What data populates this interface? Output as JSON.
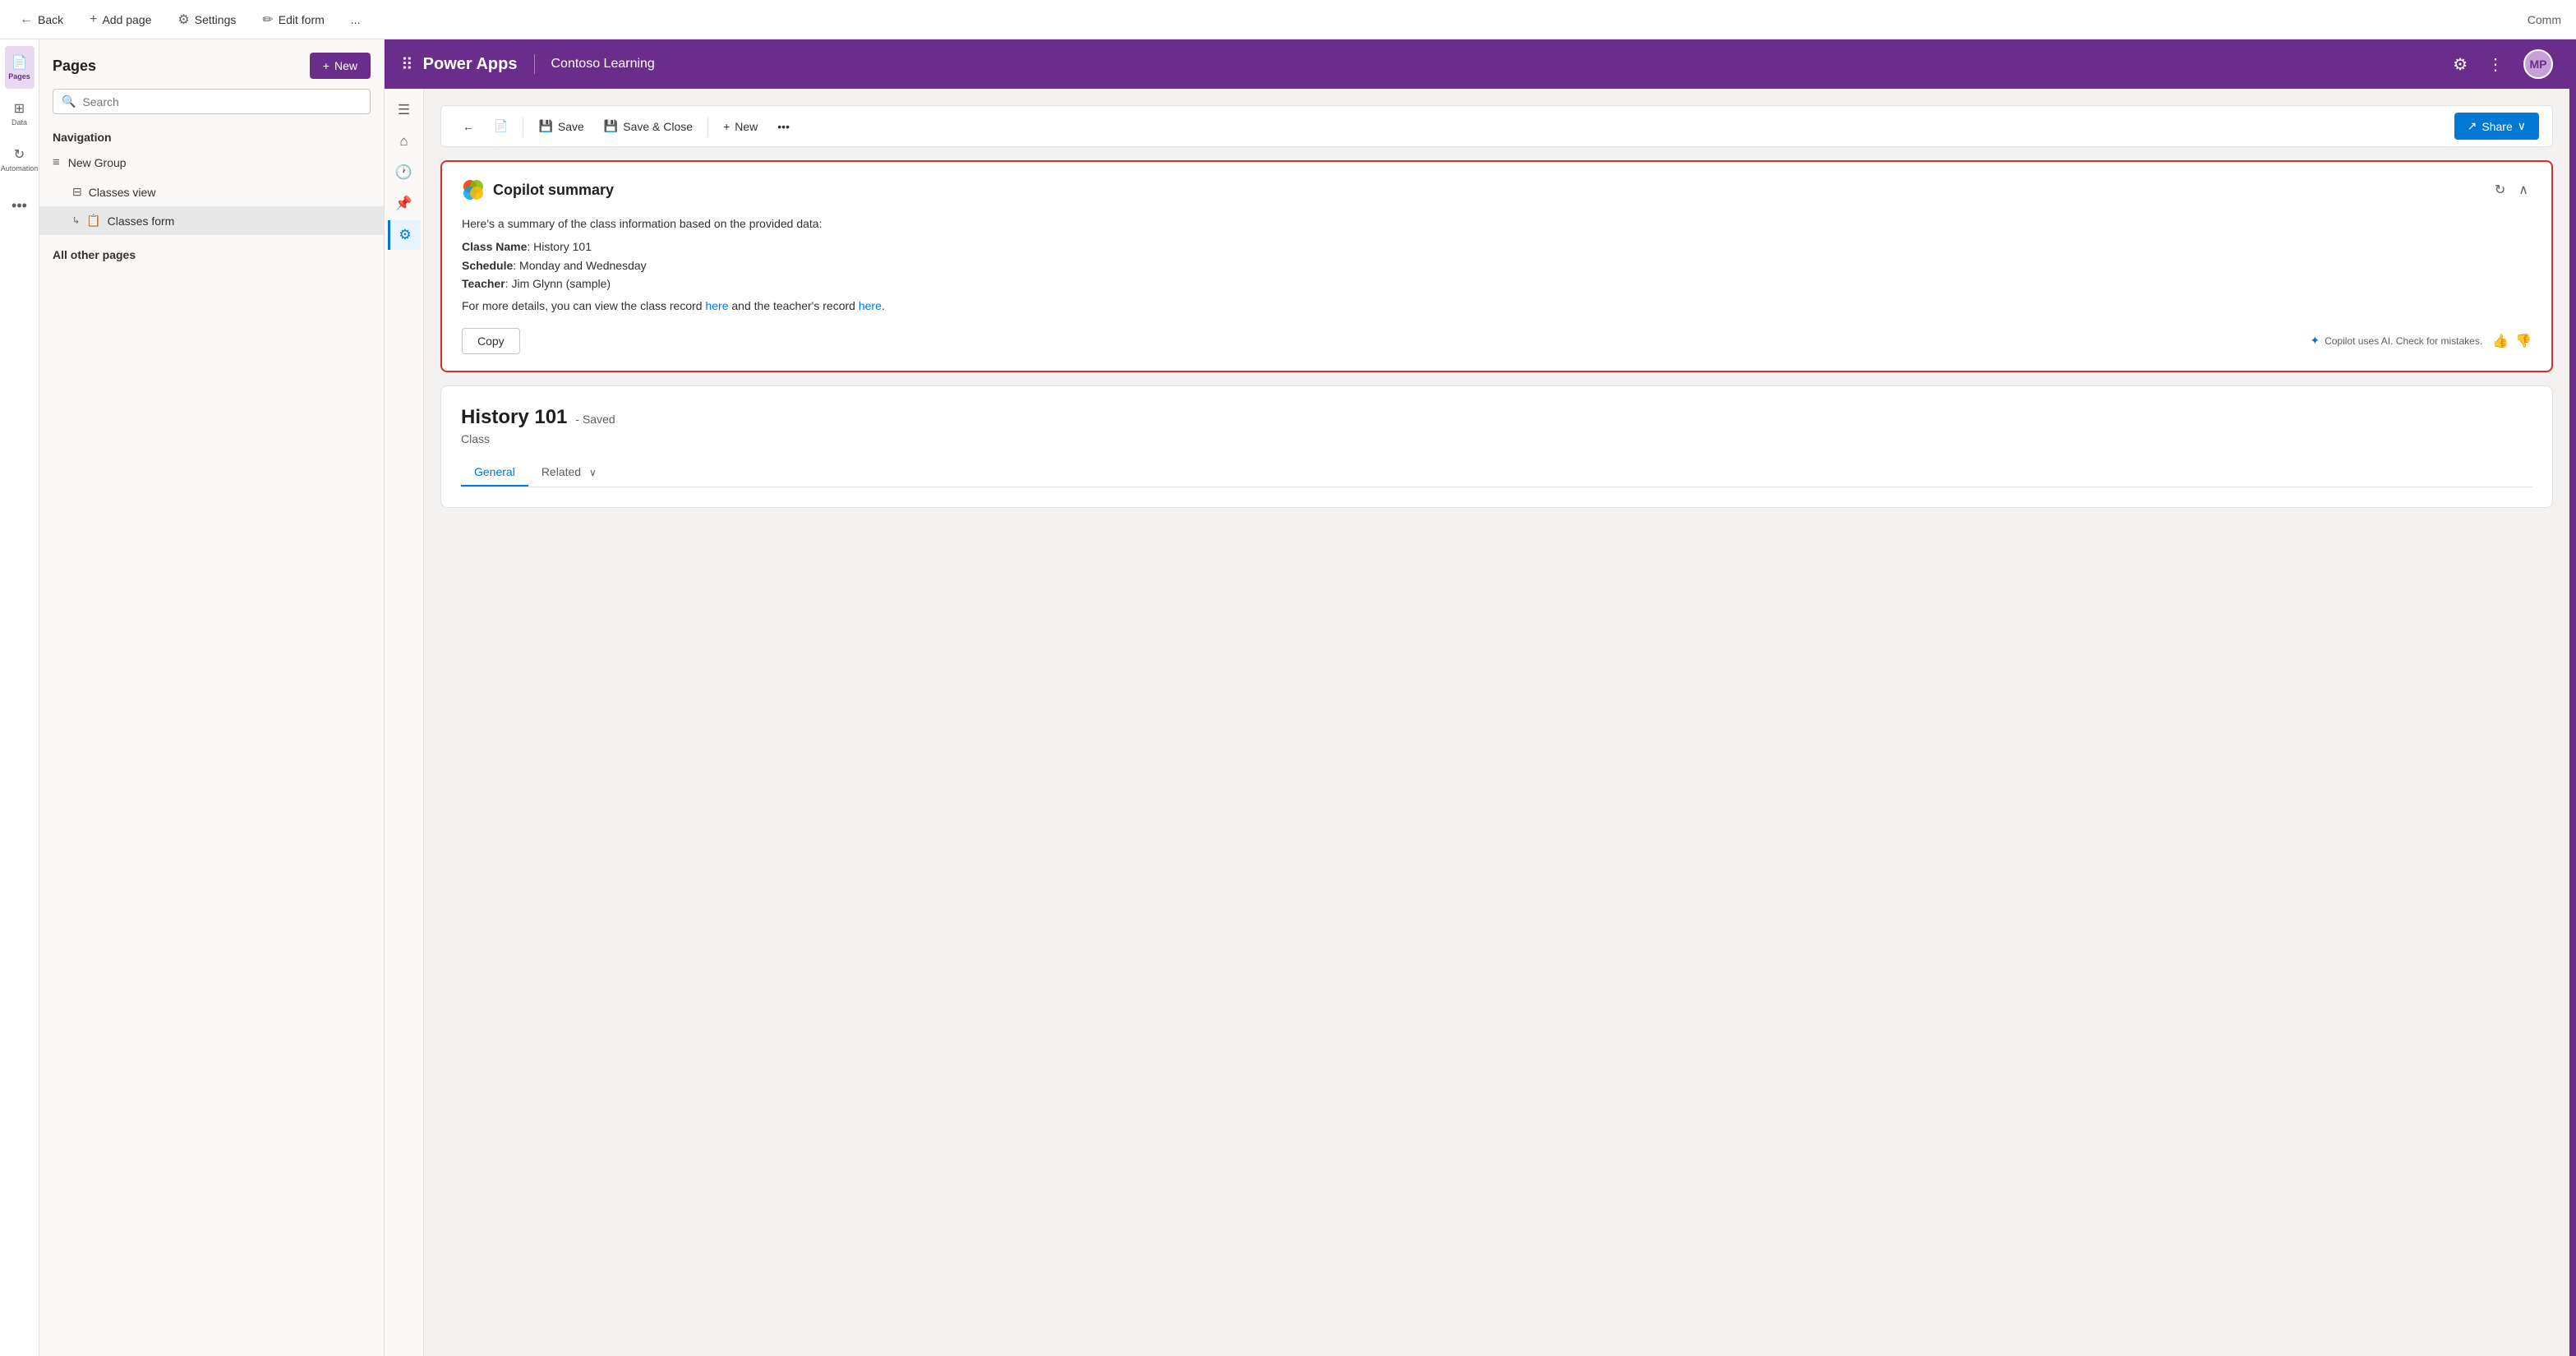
{
  "topBar": {
    "back_label": "Back",
    "add_page_label": "Add page",
    "settings_label": "Settings",
    "edit_form_label": "Edit form",
    "more_label": "..."
  },
  "sidebar": {
    "title": "Pages",
    "new_btn": "New",
    "search_placeholder": "Search",
    "nav_label": "Navigation",
    "new_group_label": "New Group",
    "classes_view_label": "Classes view",
    "classes_form_label": "Classes form",
    "all_other_pages": "All other pages"
  },
  "appHeader": {
    "title": "Power Apps",
    "subtitle": "Contoso Learning",
    "avatar_initials": "MP",
    "comm_label": "Comm"
  },
  "formToolbar": {
    "save_label": "Save",
    "save_close_label": "Save & Close",
    "new_label": "New",
    "share_label": "Share"
  },
  "copilotCard": {
    "title": "Copilot summary",
    "summary_intro": "Here's a summary of the class information based on the provided data:",
    "class_name_label": "Class Name",
    "class_name_value": "History 101",
    "schedule_label": "Schedule",
    "schedule_value": "Monday and Wednesday",
    "teacher_label": "Teacher",
    "teacher_value": "Jim Glynn (sample)",
    "more_details_prefix": "For more details, you can view the class record ",
    "here1": "here",
    "more_details_middle": " and the teacher's record ",
    "here2": "here",
    "more_details_suffix": ".",
    "copy_btn": "Copy",
    "disclaimer": "Copilot uses AI. Check for mistakes."
  },
  "recordCard": {
    "title": "History 101",
    "status": "- Saved",
    "subtitle": "Class",
    "tab_general": "General",
    "tab_related": "Related"
  },
  "icons": {
    "back": "←",
    "add": "+",
    "settings": "⚙",
    "edit": "✏",
    "more": "•••",
    "search": "🔍",
    "list": "≡",
    "pages_icon": "📄",
    "data_icon": "⊞",
    "automation_icon": "↻",
    "three_dots": "•••",
    "home": "⌂",
    "clock": "🕐",
    "pin": "📌",
    "gear2": "⚙",
    "save": "💾",
    "new_record": "📋",
    "share_icon": "↗",
    "collapse": "∧",
    "refresh": "↻",
    "thumbup": "👍",
    "thumbdown": "👎",
    "copilot_ai": "✦",
    "copilot_logo": "⬡",
    "chevron_down": "∨"
  },
  "colors": {
    "purple": "#6b2d8b",
    "blue": "#0078d4",
    "red_border": "#d32f2f",
    "text_primary": "#201f1e",
    "text_secondary": "#605e5c",
    "bg_light": "#faf9f8",
    "bg_gray": "#f3f2f1"
  }
}
